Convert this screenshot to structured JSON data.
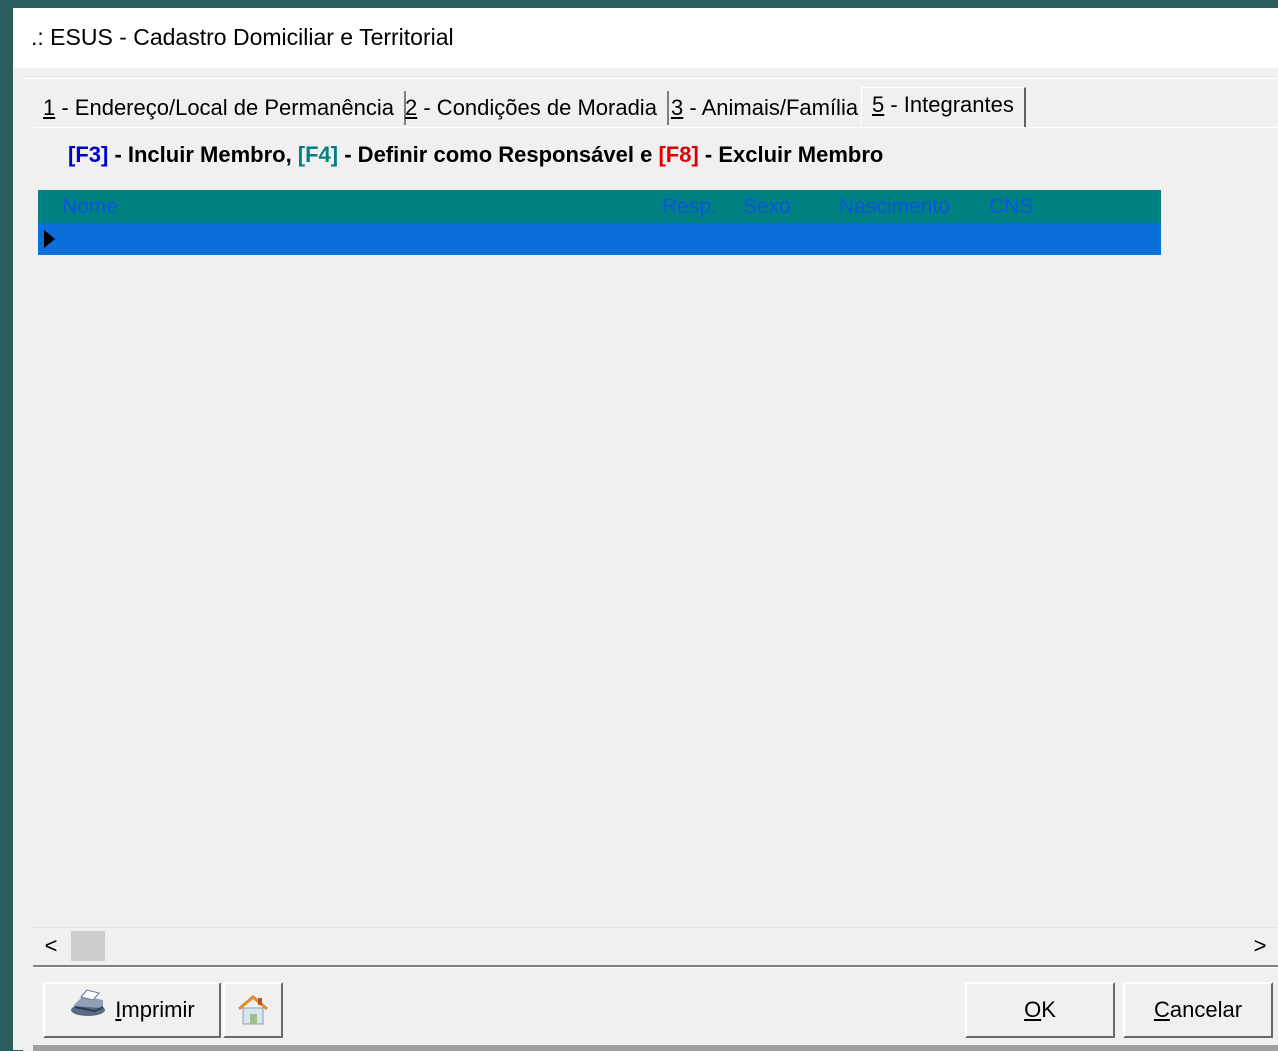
{
  "window": {
    "title": ".: ESUS - Cadastro Domiciliar e Territorial"
  },
  "tabs": [
    {
      "key": "1",
      "label": " - Endereço/Local de Permanência"
    },
    {
      "key": "2",
      "label": " - Condições de Moradia"
    },
    {
      "key": "3",
      "label": " - Animais/Família"
    },
    {
      "key": "5",
      "label": " - Integrantes",
      "active": true
    }
  ],
  "hint": {
    "f3": "[F3]",
    "t1": " - Incluir Membro, ",
    "f4": "[F4]",
    "t2": " - Definir como Responsável e ",
    "f8": "[F8]",
    "t3": " - Excluir Membro"
  },
  "grid": {
    "columns": [
      "Nome",
      "Resp.",
      "Sexo",
      "Nascimento",
      "CNS"
    ],
    "rows": []
  },
  "scrollbar": {
    "left_arrow": "<",
    "right_arrow": ">"
  },
  "buttons": {
    "print_key": "I",
    "print_rest": "mprimir",
    "ok_key": "O",
    "ok_rest": "K",
    "cancel_key": "C",
    "cancel_rest": "ancelar"
  },
  "colors": {
    "grid_header": "#008080",
    "grid_header_text": "#0a54e0",
    "selected_row": "#0a6fd8",
    "hint_f3": "#0000cc",
    "hint_f4": "#008080",
    "hint_f8": "#e00000"
  },
  "icons": [
    "printer-icon",
    "home-icon",
    "row-indicator-icon"
  ]
}
